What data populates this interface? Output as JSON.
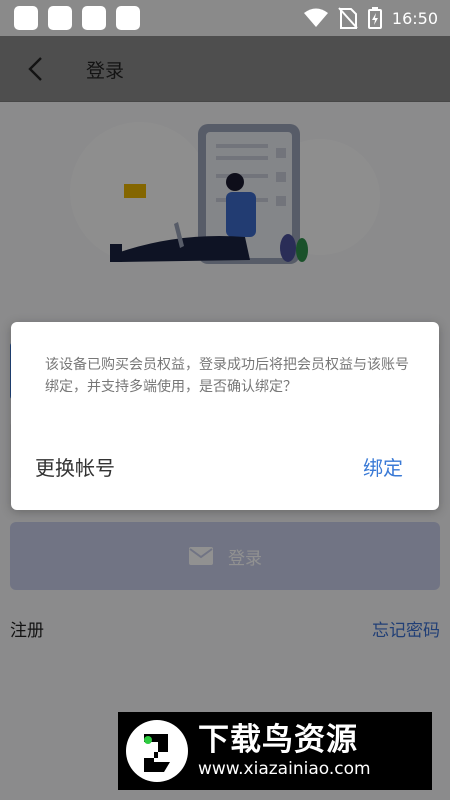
{
  "status_bar": {
    "time": "16:50",
    "icons": [
      "notification-square-icon",
      "wifi-icon",
      "no-sim-icon",
      "battery-charging-icon"
    ]
  },
  "header": {
    "title": "登录",
    "back_icon": "chevron-left-icon"
  },
  "login_form": {
    "login_button_label": "登录",
    "login_button_icon": "envelope-icon"
  },
  "links": {
    "register": "注册",
    "forgot_password": "忘记密码"
  },
  "dialog": {
    "message": "该设备已购买会员权益，登录成功后将把会员权益与该账号绑定，并支持多端使用，是否确认绑定？",
    "cancel_label": "更换帐号",
    "confirm_label": "绑定"
  },
  "watermark": {
    "title": "下载鸟资源",
    "url": "www.xiazainiao.com"
  },
  "colors": {
    "accent": "#3a7ad6",
    "link": "#3a6fcf",
    "login_button": "#c7cde8"
  }
}
